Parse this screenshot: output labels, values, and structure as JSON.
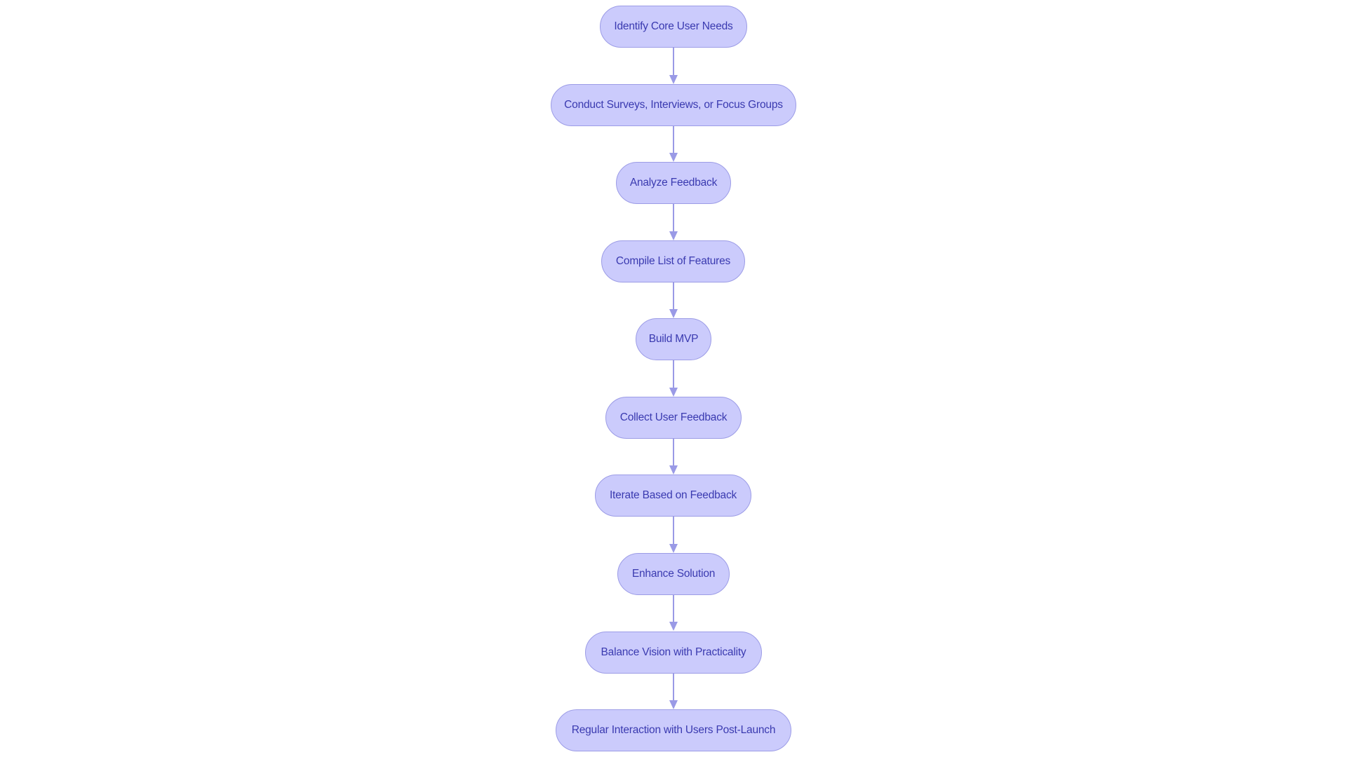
{
  "diagram": {
    "type": "flowchart",
    "direction": "top-to-bottom",
    "colors": {
      "node_fill": "#cbcbfc",
      "node_border": "#9c9ce6",
      "node_text": "#3a3ab0",
      "edge": "#9a9ae6"
    },
    "nodes": [
      {
        "id": "n1",
        "label": "Identify Core User Needs"
      },
      {
        "id": "n2",
        "label": "Conduct Surveys, Interviews, or Focus Groups"
      },
      {
        "id": "n3",
        "label": "Analyze Feedback"
      },
      {
        "id": "n4",
        "label": "Compile List of Features"
      },
      {
        "id": "n5",
        "label": "Build MVP"
      },
      {
        "id": "n6",
        "label": "Collect User Feedback"
      },
      {
        "id": "n7",
        "label": "Iterate Based on Feedback"
      },
      {
        "id": "n8",
        "label": "Enhance Solution"
      },
      {
        "id": "n9",
        "label": "Balance Vision with Practicality"
      },
      {
        "id": "n10",
        "label": "Regular Interaction with Users Post-Launch"
      }
    ],
    "edges": [
      {
        "from": "n1",
        "to": "n2"
      },
      {
        "from": "n2",
        "to": "n3"
      },
      {
        "from": "n3",
        "to": "n4"
      },
      {
        "from": "n4",
        "to": "n5"
      },
      {
        "from": "n5",
        "to": "n6"
      },
      {
        "from": "n6",
        "to": "n7"
      },
      {
        "from": "n7",
        "to": "n8"
      },
      {
        "from": "n8",
        "to": "n9"
      },
      {
        "from": "n9",
        "to": "n10"
      }
    ]
  }
}
